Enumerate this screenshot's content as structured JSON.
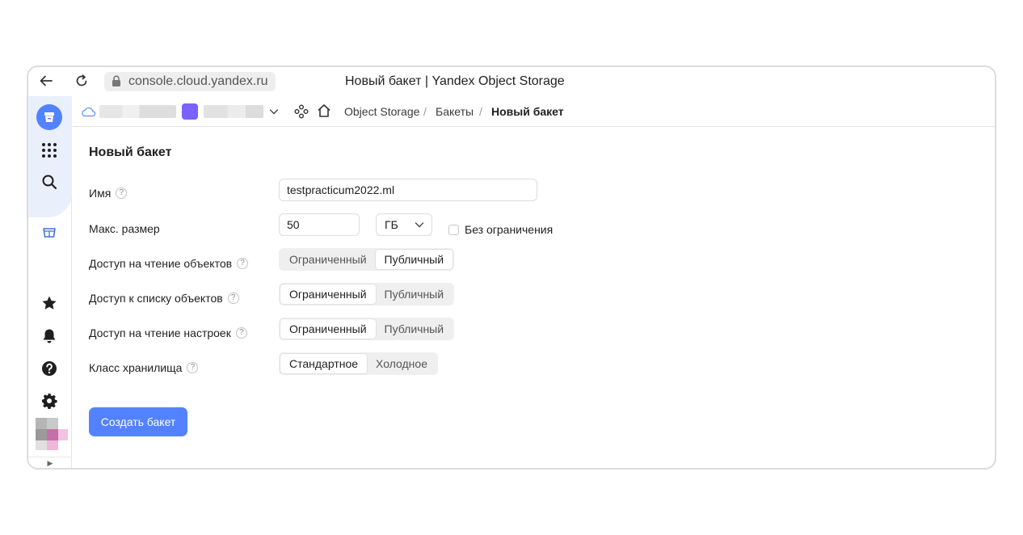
{
  "browser": {
    "url": "console.cloud.yandex.ru",
    "tab_title": "Новый бакет | Yandex Object Storage"
  },
  "breadcrumb": {
    "items": [
      "Object Storage",
      "Бакеты",
      "Новый бакет"
    ],
    "separator": "/"
  },
  "form": {
    "title": "Новый бакет",
    "name": {
      "label": "Имя",
      "value": "testpracticum2022.ml"
    },
    "max_size": {
      "label": "Макс. размер",
      "value": "50",
      "unit": "ГБ",
      "unlimited_label": "Без ограничения",
      "unlimited_checked": false
    },
    "read_access": {
      "label": "Доступ на чтение объектов",
      "options": [
        "Ограниченный",
        "Публичный"
      ],
      "selected": "Публичный"
    },
    "list_access": {
      "label": "Доступ к списку объектов",
      "options": [
        "Ограниченный",
        "Публичный"
      ],
      "selected": "Ограниченный"
    },
    "settings_access": {
      "label": "Доступ на чтение настроек",
      "options": [
        "Ограниченный",
        "Публичный"
      ],
      "selected": "Ограниченный"
    },
    "storage_class": {
      "label": "Класс хранилища",
      "options": [
        "Стандартное",
        "Холодное"
      ],
      "selected": "Стандартное"
    },
    "help_glyph": "?",
    "submit_label": "Создать бакет"
  },
  "sidebar": {
    "icons": [
      "bucket-icon",
      "apps-grid-icon",
      "search-icon",
      "object-storage-icon",
      "star-icon",
      "bell-icon",
      "help-icon",
      "gear-icon"
    ],
    "expand_glyph": "▶"
  },
  "colors": {
    "accent": "#5282ff",
    "folder": "#7b61ff",
    "segment_bg": "#efefef",
    "sidebar_highlight": "#e9f0fc"
  }
}
